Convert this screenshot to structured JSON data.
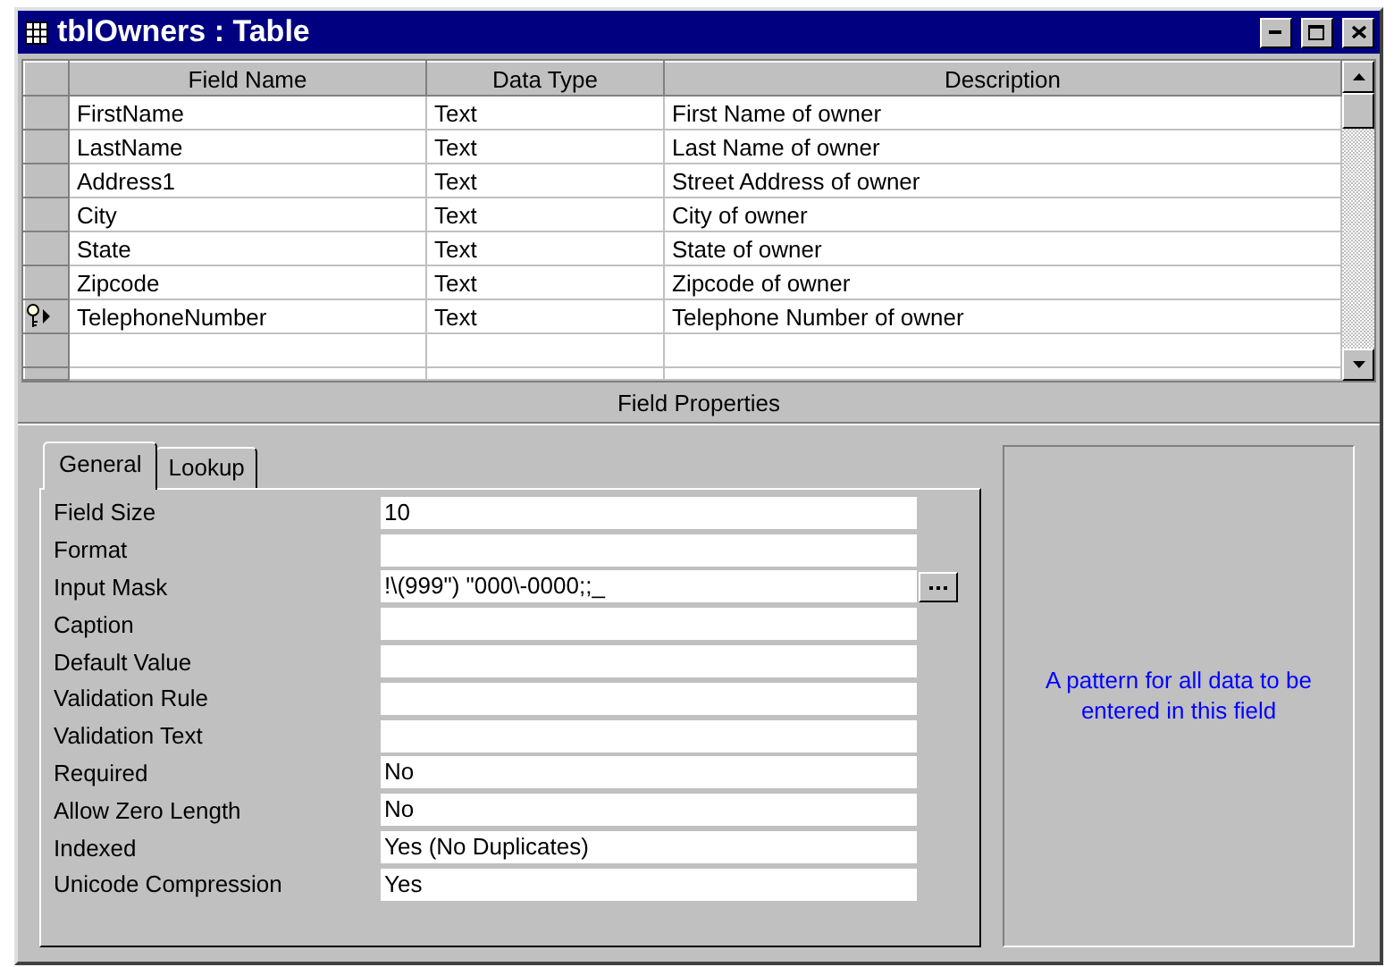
{
  "window": {
    "title": "tblOwners : Table"
  },
  "grid": {
    "columns": [
      "Field Name",
      "Data Type",
      "Description"
    ],
    "rows": [
      {
        "field_name": "FirstName",
        "data_type": "Text",
        "description": "First Name of owner",
        "primary_key": false,
        "current": false
      },
      {
        "field_name": "LastName",
        "data_type": "Text",
        "description": "Last Name of owner",
        "primary_key": false,
        "current": false
      },
      {
        "field_name": "Address1",
        "data_type": "Text",
        "description": "Street Address of owner",
        "primary_key": false,
        "current": false
      },
      {
        "field_name": "City",
        "data_type": "Text",
        "description": "City of owner",
        "primary_key": false,
        "current": false
      },
      {
        "field_name": "State",
        "data_type": "Text",
        "description": "State of owner",
        "primary_key": false,
        "current": false
      },
      {
        "field_name": "Zipcode",
        "data_type": "Text",
        "description": "Zipcode of owner",
        "primary_key": false,
        "current": false
      },
      {
        "field_name": "TelephoneNumber",
        "data_type": "Text",
        "description": "Telephone Number of owner",
        "primary_key": true,
        "current": true
      }
    ]
  },
  "field_properties": {
    "title": "Field Properties",
    "tabs": [
      {
        "label": "General",
        "selected": true
      },
      {
        "label": "Lookup",
        "selected": false
      }
    ],
    "properties": [
      {
        "label": "Field Size",
        "value": "10",
        "builder": false
      },
      {
        "label": "Format",
        "builder": false
      },
      {
        "label": "Input Mask",
        "value": "!\\(999\") \"000\\-0000;;_",
        "builder": true
      },
      {
        "label": "Caption",
        "builder": false
      },
      {
        "label": "Default Value",
        "builder": false
      },
      {
        "label": "Validation Rule",
        "builder": false
      },
      {
        "label": "Validation Text",
        "builder": false
      },
      {
        "label": "Required",
        "value": "No",
        "builder": false
      },
      {
        "label": "Allow Zero Length",
        "value": "No",
        "builder": false
      },
      {
        "label": "Indexed",
        "value": "Yes (No Duplicates)",
        "builder": false
      },
      {
        "label": "Unicode Compression",
        "value": "Yes",
        "builder": false
      }
    ],
    "help_text": "A pattern for all data to be entered in this field"
  }
}
